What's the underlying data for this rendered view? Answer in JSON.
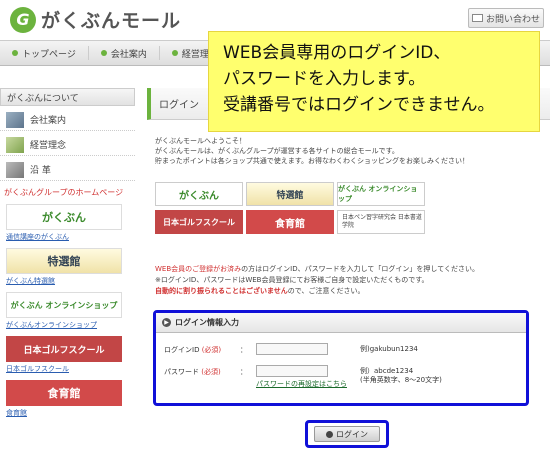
{
  "header": {
    "logo_mark": "G",
    "logo_text": "がくぶんモール",
    "contact_label": "お問い合わせ"
  },
  "nav": {
    "items": [
      "トップページ",
      "会社案内",
      "経営理念"
    ]
  },
  "sidebar": {
    "heading": "がくぶんについて",
    "items": [
      {
        "label": "会社案内",
        "icon": "building-icon"
      },
      {
        "label": "経営理念",
        "icon": "leaf-icon"
      },
      {
        "label": "沿 革",
        "icon": "history-icon"
      }
    ],
    "group_title": "がくぶんグループのホームページ",
    "banners": [
      {
        "text": "がくぶん",
        "link": "通信講座のがくぶん"
      },
      {
        "text": "特選館",
        "link": "がくぶん特選館"
      },
      {
        "text": "がくぶん オンラインショップ",
        "link": "がくぶんオンラインショップ"
      },
      {
        "text": "日本ゴルフスクール",
        "link": "日本ゴルフスクール"
      },
      {
        "text": "食育館",
        "link": "食育館"
      }
    ]
  },
  "main": {
    "title": "ログイン",
    "welcome_lines": [
      "がくぶんモールへようこそ！",
      "がくぶんモールは、がくぶんグループが運営する各サイトの総合モールです。",
      "貯まったポイントは各ショップ共通で使えます。お得なわくわくショッピングをお楽しみください！"
    ],
    "shops": [
      "がくぶん",
      "特選館",
      "がくぶん オンラインショップ",
      "日本ゴルフスクール",
      "食育館",
      "日本ペン習字研究会 日本書道学院"
    ],
    "notice": {
      "line1_red": "WEB会員のご登録がお済み",
      "line1_rest": "の方はログインID、パスワードを入力して「ログイン」を押してください。",
      "line2": "※ログインID、パスワードはWEB会員登録にてお客様ご自身で設定いただくものです。",
      "line3_bold": "自動的に割り振られることはございません",
      "line3_rest": "ので、ご注意ください。"
    },
    "panel": {
      "heading": "ログイン情報入力",
      "id_label": "ログインID",
      "required": "(必須)",
      "colon": "：",
      "id_hint": "例)gakubun1234",
      "pw_label": "パスワード",
      "pw_hint_1": "例）abcde1234",
      "pw_hint_2": "(半角英数字、8～20文字)",
      "reset_link": "パスワードの再設定はこちら",
      "id_value": "",
      "pw_value": ""
    },
    "login_button": "ログイン"
  },
  "callout": {
    "lines": [
      "WEB会員専用のログインID、",
      "パスワードを入力します。",
      "受講番号ではログインできません。"
    ]
  }
}
